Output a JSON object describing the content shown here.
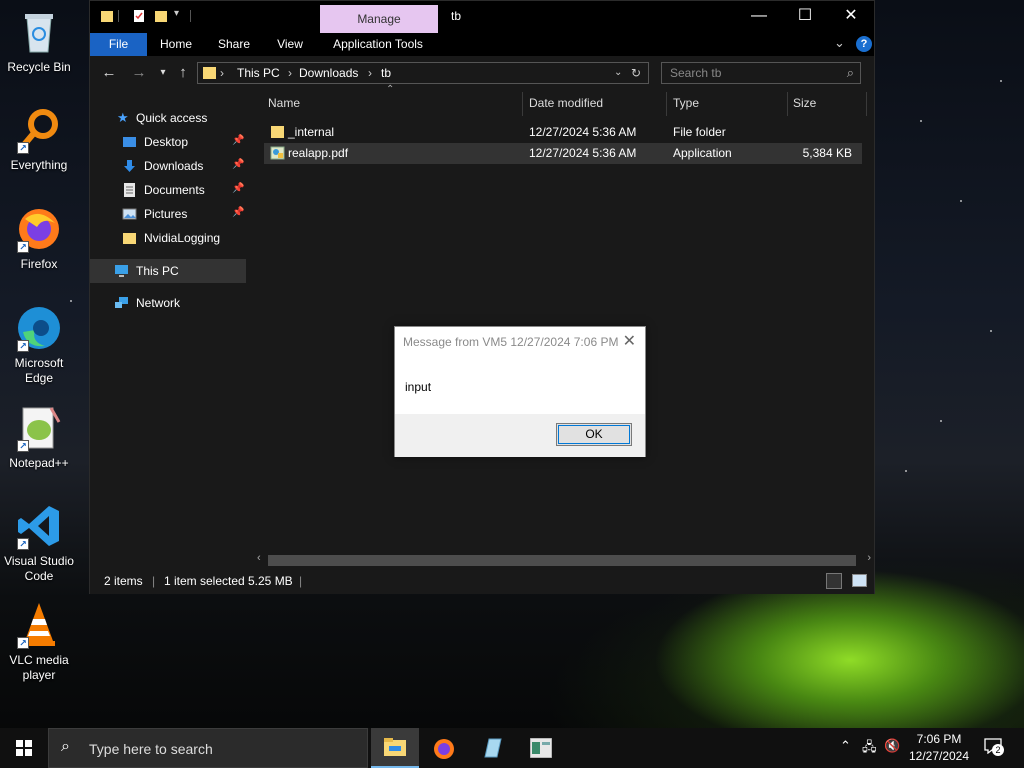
{
  "desktop": {
    "icons": [
      {
        "label": "Recycle Bin",
        "icon": "recycle-bin-icon"
      },
      {
        "label": "Everything",
        "icon": "everything-search-icon"
      },
      {
        "label": "Firefox",
        "icon": "firefox-icon"
      },
      {
        "label": "Microsoft Edge",
        "icon": "edge-icon"
      },
      {
        "label": "Notepad++",
        "icon": "notepadpp-icon"
      },
      {
        "label": "Visual Studio Code",
        "icon": "vscode-icon"
      },
      {
        "label": "VLC media player",
        "icon": "vlc-icon"
      }
    ]
  },
  "explorer": {
    "title": "tb",
    "manage_tab": "Manage",
    "ribbon_tabs": [
      "File",
      "Home",
      "Share",
      "View",
      "Application Tools"
    ],
    "breadcrumb": [
      "This PC",
      "Downloads",
      "tb"
    ],
    "search_placeholder": "Search tb",
    "nav": {
      "quick_access": "Quick access",
      "items": [
        "Desktop",
        "Downloads",
        "Documents",
        "Pictures",
        "NvidiaLogging"
      ],
      "this_pc": "This PC",
      "network": "Network"
    },
    "columns": [
      "Name",
      "Date modified",
      "Type",
      "Size"
    ],
    "files": [
      {
        "name": "_internal",
        "date": "12/27/2024 5:36 AM",
        "type": "File folder",
        "size": ""
      },
      {
        "name": "realapp.pdf",
        "date": "12/27/2024 5:36 AM",
        "type": "Application",
        "size": "5,384 KB"
      }
    ],
    "status": {
      "count": "2 items",
      "selected": "1 item selected",
      "size": "5.25 MB"
    }
  },
  "dialog": {
    "title": "Message from VM5 12/27/2024 7:06 PM",
    "message": "input",
    "ok_label": "OK"
  },
  "taskbar": {
    "search_placeholder": "Type here to search",
    "time": "7:06 PM",
    "date": "12/27/2024",
    "notifications": "2"
  }
}
